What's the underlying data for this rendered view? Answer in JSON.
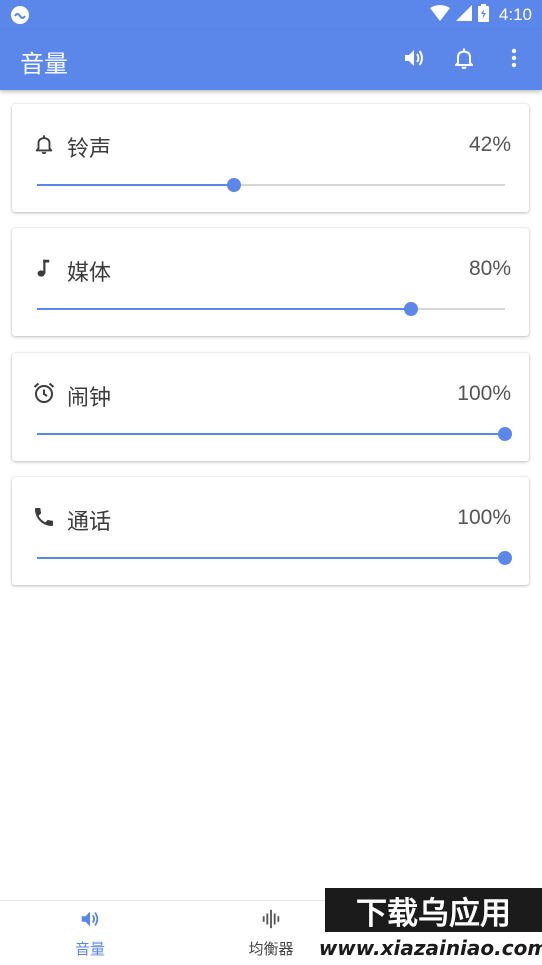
{
  "status_bar": {
    "time": "4:10",
    "icons": [
      "cat-icon",
      "wifi-icon",
      "signal-icon",
      "battery-icon"
    ]
  },
  "app_bar": {
    "title": "音量",
    "actions": [
      "speaker-icon",
      "bell-icon",
      "more-vert-icon"
    ]
  },
  "volumes": [
    {
      "label": "铃声",
      "value_text": "42%",
      "level": 0.42,
      "icon": "bell-icon"
    },
    {
      "label": "媒体",
      "value_text": "80%",
      "level": 0.8,
      "icon": "music-note-icon"
    },
    {
      "label": "闹钟",
      "value_text": "100%",
      "level": 1.0,
      "icon": "alarm-clock-icon"
    },
    {
      "label": "通话",
      "value_text": "100%",
      "level": 1.0,
      "icon": "phone-icon"
    }
  ],
  "bottom_nav": {
    "items": [
      {
        "label": "音量",
        "icon": "speaker-icon",
        "active": true
      },
      {
        "label": "均衡器",
        "icon": "equalizer-icon",
        "active": false
      }
    ]
  },
  "watermark": {
    "line1": "下载乌应用",
    "line2": "www.xiazainiao.com"
  },
  "colors": {
    "accent": "#5b86ea",
    "track": "#d6d6d6",
    "text": "#3c3c3c",
    "inactive": "#555555"
  }
}
